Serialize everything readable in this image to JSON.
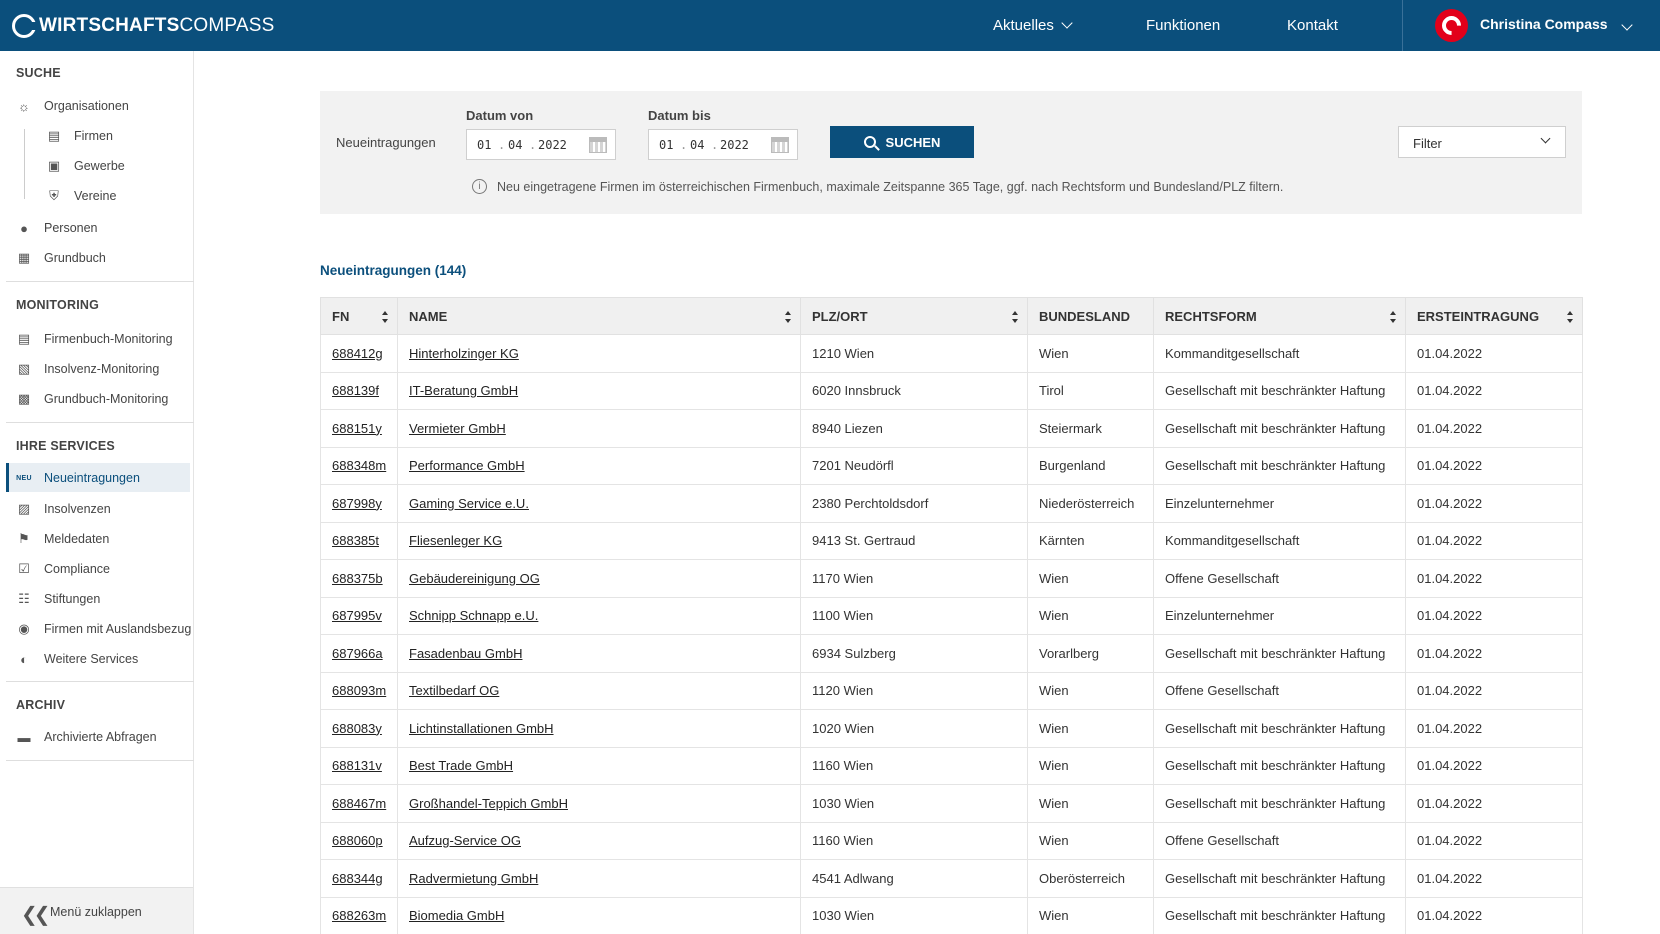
{
  "header": {
    "logo_bold": "WIRTSCHAFTS",
    "logo_light": "COMPASS",
    "nav": {
      "aktuelles": "Aktuelles",
      "funktionen": "Funktionen",
      "kontakt": "Kontakt"
    },
    "user_name": "Christina Compass"
  },
  "sidebar": {
    "suche_title": "SUCHE",
    "organisationen": "Organisationen",
    "firmen": "Firmen",
    "gewerbe": "Gewerbe",
    "vereine": "Vereine",
    "personen": "Personen",
    "grundbuch": "Grundbuch",
    "monitoring_title": "MONITORING",
    "firmenbuch_monitoring": "Firmenbuch-Monitoring",
    "insolvenz_monitoring": "Insolvenz-Monitoring",
    "grundbuch_monitoring": "Grundbuch-Monitoring",
    "services_title": "IHRE SERVICES",
    "neu_badge": "NEU",
    "neueintragungen": "Neueintragungen",
    "insolvenzen": "Insolvenzen",
    "meldedaten": "Meldedaten",
    "compliance": "Compliance",
    "stiftungen": "Stiftungen",
    "auslandsbezug": "Firmen mit Auslandsbezug",
    "weitere": "Weitere Services",
    "archiv_title": "ARCHIV",
    "archivierte": "Archivierte Abfragen",
    "collapse": "Menü zuklappen"
  },
  "search": {
    "label": "Neueintragungen",
    "from_title": "Datum von",
    "from": {
      "day": "01",
      "month": "04",
      "year": "2022"
    },
    "to_title": "Datum bis",
    "to": {
      "day": "01",
      "month": "04",
      "year": "2022"
    },
    "button": "SUCHEN",
    "filter": "Filter",
    "info": "Neu eingetragene Firmen im österreichischen Firmenbuch, maximale Zeitspanne 365 Tage, ggf. nach Rechtsform und Bundesland/PLZ filtern."
  },
  "results": {
    "title": "Neueintragungen (144)",
    "columns": [
      "FN",
      "NAME",
      "PLZ/ORT",
      "BUNDESLAND",
      "RECHTSFORM",
      "ERSTEINTRAGUNG"
    ],
    "rows": [
      [
        "688412g",
        "Hinterholzinger KG",
        "1210 Wien",
        "Wien",
        "Kommanditgesellschaft",
        "01.04.2022"
      ],
      [
        "688139f",
        "IT-Beratung GmbH",
        "6020 Innsbruck",
        "Tirol",
        "Gesellschaft mit beschränkter Haftung",
        "01.04.2022"
      ],
      [
        "688151y",
        "Vermieter GmbH",
        "8940 Liezen",
        "Steiermark",
        "Gesellschaft mit beschränkter Haftung",
        "01.04.2022"
      ],
      [
        "688348m",
        "Performance GmbH",
        "7201 Neudörfl",
        "Burgenland",
        "Gesellschaft mit beschränkter Haftung",
        "01.04.2022"
      ],
      [
        "687998y",
        "Gaming Service e.U.",
        "2380 Perchtoldsdorf",
        "Niederösterreich",
        "Einzelunternehmer",
        "01.04.2022"
      ],
      [
        "688385t",
        "Fliesenleger KG",
        "9413 St. Gertraud",
        "Kärnten",
        "Kommanditgesellschaft",
        "01.04.2022"
      ],
      [
        "688375b",
        "Gebäudereinigung OG",
        "1170 Wien",
        "Wien",
        "Offene Gesellschaft",
        "01.04.2022"
      ],
      [
        "687995v",
        "Schnipp Schnapp e.U.",
        "1100 Wien",
        "Wien",
        "Einzelunternehmer",
        "01.04.2022"
      ],
      [
        "687966a",
        "Fasadenbau GmbH",
        "6934 Sulzberg",
        "Vorarlberg",
        "Gesellschaft mit beschränkter Haftung",
        "01.04.2022"
      ],
      [
        "688093m",
        "Textilbedarf OG",
        "1120 Wien",
        "Wien",
        "Offene Gesellschaft",
        "01.04.2022"
      ],
      [
        "688083y",
        "Lichtinstallationen GmbH",
        "1020 Wien",
        "Wien",
        "Gesellschaft mit beschränkter Haftung",
        "01.04.2022"
      ],
      [
        "688131v",
        "Best Trade GmbH",
        "1160 Wien",
        "Wien",
        "Gesellschaft mit beschränkter Haftung",
        "01.04.2022"
      ],
      [
        "688467m",
        "Großhandel-Teppich GmbH",
        "1030 Wien",
        "Wien",
        "Gesellschaft mit beschränkter Haftung",
        "01.04.2022"
      ],
      [
        "688060p",
        "Aufzug-Service OG",
        "1160 Wien",
        "Wien",
        "Offene Gesellschaft",
        "01.04.2022"
      ],
      [
        "688344g",
        "Radvermietung GmbH",
        "4541 Adlwang",
        "Oberösterreich",
        "Gesellschaft mit beschränkter Haftung",
        "01.04.2022"
      ],
      [
        "688263m",
        "Biomedia GmbH",
        "1030 Wien",
        "Wien",
        "Gesellschaft mit beschränkter Haftung",
        "01.04.2022"
      ]
    ]
  },
  "colors": {
    "brand": "#0b4f7c",
    "accent": "#e2001a",
    "panel": "#f2f2f2"
  }
}
